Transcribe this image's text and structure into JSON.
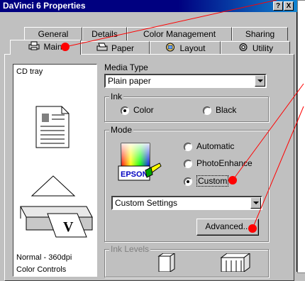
{
  "window": {
    "title": "DaVinci 6 Properties",
    "help_glyph": "?",
    "close_glyph": "X"
  },
  "tabs_row1": [
    {
      "label": "General"
    },
    {
      "label": "Details"
    },
    {
      "label": "Color Management"
    },
    {
      "label": "Sharing"
    }
  ],
  "tabs_row2": [
    {
      "label": "Main",
      "icon": "printer-icon"
    },
    {
      "label": "Paper",
      "icon": "paper-icon"
    },
    {
      "label": "Layout",
      "icon": "layout-icon"
    },
    {
      "label": "Utility",
      "icon": "utility-icon"
    }
  ],
  "preview": {
    "title": "CD tray",
    "footer1": "Normal - 360dpi",
    "footer2": "Color Controls"
  },
  "media_type": {
    "label": "Media Type",
    "value": "Plain paper"
  },
  "ink": {
    "label": "Ink",
    "options": [
      {
        "label": "Color",
        "selected": true
      },
      {
        "label": "Black",
        "selected": false
      }
    ]
  },
  "mode": {
    "label": "Mode",
    "options": [
      {
        "label": "Automatic",
        "selected": false
      },
      {
        "label": "PhotoEnhance",
        "selected": false
      },
      {
        "label": "Custom",
        "selected": true
      }
    ],
    "logo_text": "EPSON",
    "settings_value": "Custom Settings",
    "advanced_label": "Advanced..."
  },
  "ink_levels": {
    "label": "Ink Levels"
  },
  "colors": {
    "title_bar": "#000080",
    "marker": "#ff0000",
    "face": "#c0c0c0"
  }
}
